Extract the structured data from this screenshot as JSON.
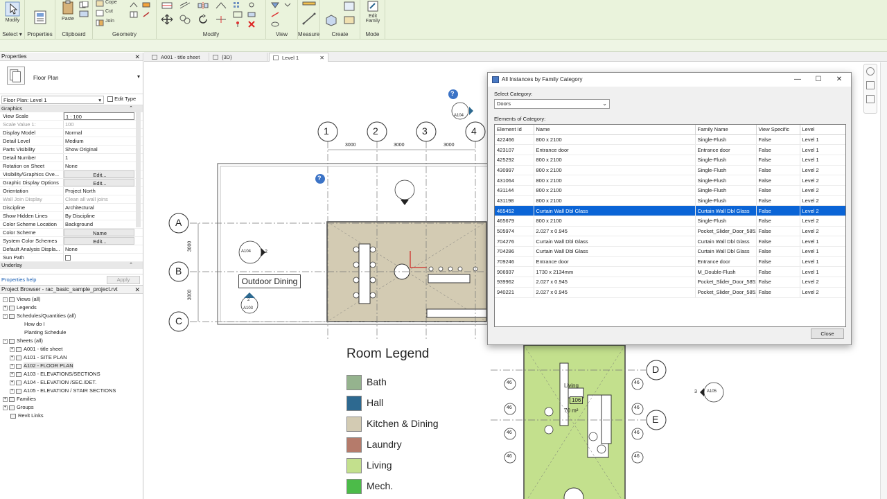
{
  "ribbon": {
    "groups": [
      {
        "label": "Select",
        "has_dropdown": true
      },
      {
        "label": "Properties"
      },
      {
        "label": "Clipboard"
      },
      {
        "label": "Geometry"
      },
      {
        "label": "Modify"
      },
      {
        "label": "View"
      },
      {
        "label": "Measure"
      },
      {
        "label": "Create"
      },
      {
        "label": "Mode"
      }
    ],
    "modify_label": "Modify",
    "paste_label": "Paste",
    "cope_label": "Cope",
    "cut_label": "Cut",
    "join_label": "Join",
    "edit_family_label": "Edit Family",
    "edit_family_line1": "Edit",
    "edit_family_line2": "Family"
  },
  "properties": {
    "title": "Properties",
    "type_name": "Floor Plan",
    "instance_selector": "Floor Plan: Level 1",
    "edit_type_label": "Edit Type",
    "graphics_section": "Graphics",
    "rows": [
      {
        "key": "View Scale",
        "value": "1 : 100",
        "style": "boxed"
      },
      {
        "key": "Scale Value    1:",
        "value": "100",
        "style": "grey"
      },
      {
        "key": "Display Model",
        "value": "Normal"
      },
      {
        "key": "Detail Level",
        "value": "Medium"
      },
      {
        "key": "Parts Visibility",
        "value": "Show Original"
      },
      {
        "key": "Detail Number",
        "value": "1"
      },
      {
        "key": "Rotation on Sheet",
        "value": "None"
      },
      {
        "key": "Visibility/Graphics Ove...",
        "value": "Edit...",
        "style": "btn"
      },
      {
        "key": "Graphic Display Options",
        "value": "Edit...",
        "style": "btn"
      },
      {
        "key": "Orientation",
        "value": "Project North"
      },
      {
        "key": "Wall Join Display",
        "value": "Clean all wall joins",
        "style": "grey"
      },
      {
        "key": "Discipline",
        "value": "Architectural"
      },
      {
        "key": "Show Hidden Lines",
        "value": "By Discipline"
      },
      {
        "key": "Color Scheme Location",
        "value": "Background"
      },
      {
        "key": "Color Scheme",
        "value": "Name",
        "style": "btn"
      },
      {
        "key": "System Color Schemes",
        "value": "Edit...",
        "style": "btn"
      },
      {
        "key": "Default Analysis Displa...",
        "value": "None"
      },
      {
        "key": "Sun Path",
        "value": "",
        "style": "check"
      }
    ],
    "underlay_section": "Underlay",
    "help_link": "Properties help",
    "apply_label": "Apply"
  },
  "browser": {
    "title": "Project Browser - rac_basic_sample_project.rvt",
    "items": [
      {
        "label": "Views (all)",
        "level": 0,
        "toggle": "-"
      },
      {
        "label": "Legends",
        "level": 0,
        "toggle": "+"
      },
      {
        "label": "Schedules/Quantities (all)",
        "level": 0,
        "toggle": "-"
      },
      {
        "label": "How do I",
        "level": 2,
        "toggle": ""
      },
      {
        "label": "Planting Schedule",
        "level": 2,
        "toggle": ""
      },
      {
        "label": "Sheets (all)",
        "level": 0,
        "toggle": "-"
      },
      {
        "label": "A001 - title sheet",
        "level": 1,
        "toggle": "+"
      },
      {
        "label": "A101 - SITE PLAN",
        "level": 1,
        "toggle": "+"
      },
      {
        "label": "A102 - FLOOR PLAN",
        "level": 1,
        "toggle": "+",
        "selected": true
      },
      {
        "label": "A103 - ELEVATIONS/SECTIONS",
        "level": 1,
        "toggle": "+"
      },
      {
        "label": "A104 - ELEVATION /SEC./DET.",
        "level": 1,
        "toggle": "+"
      },
      {
        "label": "A105 - ELEVATION / STAIR SECTIONS",
        "level": 1,
        "toggle": "+"
      },
      {
        "label": "Families",
        "level": 0,
        "toggle": "+"
      },
      {
        "label": "Groups",
        "level": 0,
        "toggle": "+"
      },
      {
        "label": "Revit Links",
        "level": 0,
        "toggle": ""
      }
    ]
  },
  "tabs": [
    {
      "label": "A001 - title sheet",
      "active": false
    },
    {
      "label": "{3D}",
      "active": false
    },
    {
      "label": "Level 1",
      "active": true
    }
  ],
  "plan": {
    "grid_top": [
      "1",
      "2",
      "3",
      "4"
    ],
    "grid_left": [
      "A",
      "B",
      "C"
    ],
    "grid_right": [
      "D",
      "E"
    ],
    "dims_top": [
      "3000",
      "3000",
      "3000"
    ],
    "dims_left": [
      "3000",
      "3000"
    ],
    "outdoor_dining": "Outdoor Dining",
    "tags": {
      "a104": "A104",
      "a103": "A103",
      "a103_num": "2",
      "a105": "A105",
      "a105_num": "3",
      "a104_2_label": "A104",
      "a104_2_num": "2",
      "room_num": "106",
      "room_name": "Living",
      "room_area": "70 m²",
      "elev": "46"
    }
  },
  "legend": {
    "title": "Room Legend",
    "items": [
      {
        "label": "Bath",
        "color": "#95b38e"
      },
      {
        "label": "Hall",
        "color": "#2d6990"
      },
      {
        "label": "Kitchen & Dining",
        "color": "#d3cbb3"
      },
      {
        "label": "Laundry",
        "color": "#b57b6b"
      },
      {
        "label": "Living",
        "color": "#c3e08d"
      },
      {
        "label": "Mech.",
        "color": "#4cbb49"
      }
    ]
  },
  "dialog": {
    "title": "All Instances by Family Category",
    "select_category_label": "Select Category:",
    "category_value": "Doors",
    "elements_label": "Elements of Category:",
    "columns": [
      "Element Id",
      "Name",
      "Family Name",
      "View Specific",
      "Level"
    ],
    "rows": [
      [
        "422466",
        "800 x 2100",
        "Single-Flush",
        "False",
        "Level 1"
      ],
      [
        "423107",
        "Entrance door",
        "Entrance door",
        "False",
        "Level 1"
      ],
      [
        "425292",
        "800 x 2100",
        "Single-Flush",
        "False",
        "Level 1"
      ],
      [
        "430997",
        "800 x 2100",
        "Single-Flush",
        "False",
        "Level 2"
      ],
      [
        "431064",
        "800 x 2100",
        "Single-Flush",
        "False",
        "Level 2"
      ],
      [
        "431144",
        "800 x 2100",
        "Single-Flush",
        "False",
        "Level 2"
      ],
      [
        "431198",
        "800 x 2100",
        "Single-Flush",
        "False",
        "Level 2"
      ],
      [
        "465452",
        "Curtain Wall Dbl Glass",
        "Curtain Wall Dbl Glass",
        "False",
        "Level 2"
      ],
      [
        "465679",
        "800 x 2100",
        "Single-Flush",
        "False",
        "Level 2"
      ],
      [
        "505974",
        "2.027 x 0.945",
        "Pocket_Slider_Door_5851",
        "False",
        "Level 2"
      ],
      [
        "704276",
        "Curtain Wall Dbl Glass",
        "Curtain Wall Dbl Glass",
        "False",
        "Level 1"
      ],
      [
        "704286",
        "Curtain Wall Dbl Glass",
        "Curtain Wall Dbl Glass",
        "False",
        "Level 1"
      ],
      [
        "709246",
        "Entrance door",
        "Entrance door",
        "False",
        "Level 1"
      ],
      [
        "906937",
        "1730 x 2134mm",
        "M_Double-Flush",
        "False",
        "Level 1"
      ],
      [
        "939962",
        "2.027 x 0.945",
        "Pocket_Slider_Door_5851",
        "False",
        "Level 2"
      ],
      [
        "940221",
        "2.027 x 0.945",
        "Pocket_Slider_Door_5851",
        "False",
        "Level 2"
      ]
    ],
    "selected_row": 7,
    "close_label": "Close"
  }
}
